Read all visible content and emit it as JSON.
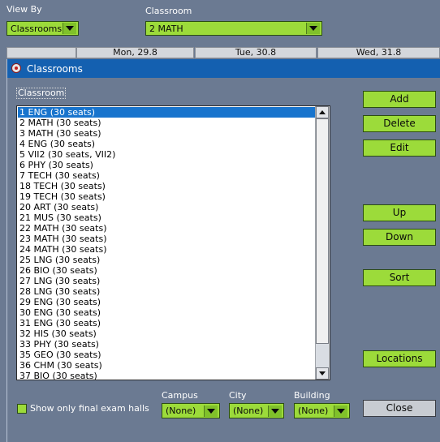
{
  "toolbar": {
    "view_by_label": "View By",
    "view_by_value": "Classrooms",
    "classroom_label": "Classroom",
    "classroom_value": "2 MATH"
  },
  "days": [
    "Mon, 29.8",
    "Tue, 30.8",
    "Wed, 31.8"
  ],
  "dialog": {
    "title": "Classrooms",
    "group_label": "Classroom",
    "items": [
      "1 ENG (30 seats)",
      "2 MATH (30 seats)",
      "3 MATH (30 seats)",
      "4 ENG (30 seats)",
      "5 VII2 (30 seats, VII2)",
      "6 PHY (30 seats)",
      "7 TECH (30 seats)",
      "18 TECH (30 seats)",
      "19 TECH (30 seats)",
      "20 ART (30 seats)",
      "21 MUS (30 seats)",
      "22 MATH (30 seats)",
      "23 MATH (30 seats)",
      "24 MATH (30 seats)",
      "25 LNG (30 seats)",
      "26 BIO (30 seats)",
      "27 LNG (30 seats)",
      "28 LNG (30 seats)",
      "29 ENG (30 seats)",
      "30 ENG (30 seats)",
      "31 ENG (30 seats)",
      "32 HIS (30 seats)",
      "33 PHY (30 seats)",
      "35 GEO (30 seats)",
      "36 CHM (30 seats)",
      "37 BIO (30 seats)"
    ],
    "selected_index": 0,
    "buttons": {
      "add": "Add",
      "delete": "Delete",
      "edit": "Edit",
      "up": "Up",
      "down": "Down",
      "sort": "Sort",
      "locations": "Locations",
      "close": "Close"
    },
    "final_exam_label": "Show only final exam halls",
    "filters": {
      "campus_label": "Campus",
      "campus_value": "(None)",
      "city_label": "City",
      "city_value": "(None)",
      "building_label": "Building",
      "building_value": "(None)"
    }
  },
  "colors": {
    "accent_green": "#9cdb3a",
    "title_blue": "#1460b0",
    "selection_blue": "#1874cd",
    "background": "#6b7a92"
  }
}
